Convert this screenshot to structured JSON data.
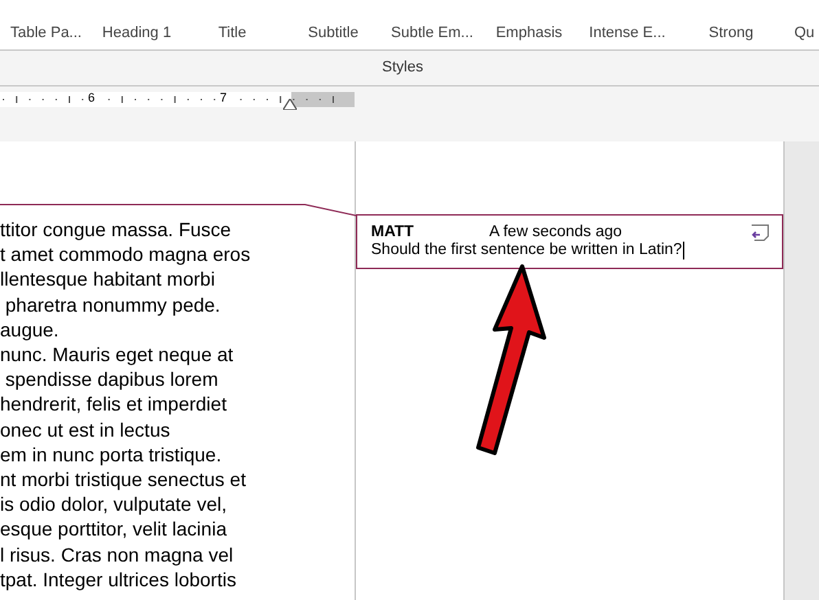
{
  "ribbon": {
    "styles": [
      {
        "label": "Table Pa..."
      },
      {
        "label": "Heading 1"
      },
      {
        "label": "Title"
      },
      {
        "label": "Subtitle"
      },
      {
        "label": "Subtle Em..."
      },
      {
        "label": "Emphasis"
      },
      {
        "label": "Intense E..."
      },
      {
        "label": "Strong"
      },
      {
        "label": "Qu"
      }
    ],
    "group_label": "Styles"
  },
  "ruler": {
    "numbers": [
      "6",
      "7"
    ]
  },
  "document": {
    "lines": [
      "ttitor congue massa. Fusce",
      "t amet commodo magna eros",
      "llentesque habitant morbi",
      " pharetra nonummy pede.",
      "augue.",
      "nunc. Mauris eget neque at",
      " spendisse dapibus lorem",
      "hendrerit, felis et imperdiet",
      "onec ut est in lectus",
      "em in nunc porta tristique.",
      "nt morbi tristique senectus et",
      "is odio dolor, vulputate vel,",
      "esque porttitor, velit lacinia",
      "l risus. Cras non magna vel",
      "tpat. Integer ultrices lobortis"
    ]
  },
  "comment": {
    "author": "MATT",
    "time": "A few seconds ago",
    "text": "Should the first sentence be written in Latin?"
  }
}
